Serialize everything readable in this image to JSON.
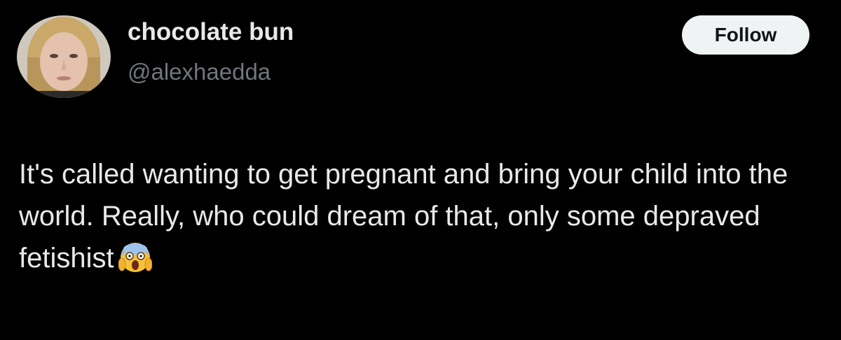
{
  "user": {
    "display_name": "chocolate bun",
    "handle": "@alexhaedda"
  },
  "follow_button": {
    "label": "Follow"
  },
  "tweet": {
    "text": "It's called wanting to get pregnant and bring your child into the world. Really, who could dream of that, only some depraved fetishist",
    "emoji": "screaming-face-icon"
  },
  "colors": {
    "background": "#000000",
    "primary_text": "#e7e9ea",
    "secondary_text": "#71767b",
    "button_bg": "#eff3f4",
    "button_text": "#0f1419"
  }
}
